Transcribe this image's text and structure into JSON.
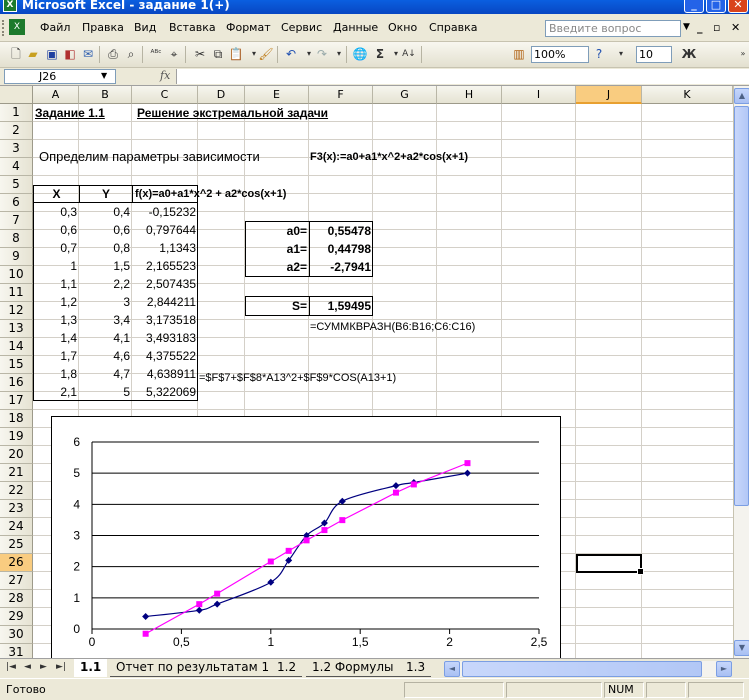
{
  "window": {
    "title": "Microsoft Excel - задание 1(+)"
  },
  "menu": {
    "items": [
      "Файл",
      "Правка",
      "Вид",
      "Вставка",
      "Формат",
      "Сервис",
      "Данные",
      "Окно",
      "Справка"
    ],
    "help_placeholder": "Введите вопрос"
  },
  "toolbar": {
    "zoom": "100%",
    "font_size": "10",
    "bold_label": "Ж"
  },
  "formula_bar": {
    "cell_ref": "J26",
    "fx_label": "fx",
    "content": ""
  },
  "columns": [
    "A",
    "B",
    "C",
    "D",
    "E",
    "F",
    "G",
    "H",
    "I",
    "J",
    "K"
  ],
  "selected_column": "J",
  "selected_row": "26",
  "rows": [
    "1",
    "2",
    "3",
    "4",
    "5",
    "6",
    "7",
    "8",
    "9",
    "10",
    "11",
    "12",
    "13",
    "14",
    "15",
    "16",
    "17",
    "18",
    "19",
    "20",
    "21",
    "22",
    "23",
    "24",
    "25",
    "26",
    "27",
    "28",
    "29",
    "30",
    "31"
  ],
  "sheet": {
    "title_task": "Задание 1.1",
    "title_solution": "Решение экстремальной задачи",
    "params_text": "Определим параметры зависимости",
    "params_formula": "F3(x):=a0+a1*x^2+a2*cos(x+1)",
    "table_headers": {
      "x": "X",
      "y": "Y",
      "f": "f(x)=a0+a1*x^2 + a2*cos(x+1)"
    },
    "table": [
      {
        "x": "0,3",
        "y": "0,4",
        "f": "-0,15232"
      },
      {
        "x": "0,6",
        "y": "0,6",
        "f": "0,797644"
      },
      {
        "x": "0,7",
        "y": "0,8",
        "f": "1,1343"
      },
      {
        "x": "1",
        "y": "1,5",
        "f": "2,165523"
      },
      {
        "x": "1,1",
        "y": "2,2",
        "f": "2,507435"
      },
      {
        "x": "1,2",
        "y": "3",
        "f": "2,844211"
      },
      {
        "x": "1,3",
        "y": "3,4",
        "f": "3,173518"
      },
      {
        "x": "1,4",
        "y": "4,1",
        "f": "3,493183"
      },
      {
        "x": "1,7",
        "y": "4,6",
        "f": "4,375522"
      },
      {
        "x": "1,8",
        "y": "4,7",
        "f": "4,638911"
      },
      {
        "x": "2,1",
        "y": "5",
        "f": "5,322069"
      }
    ],
    "row15_formula": "=$F$7+$F$8*A13^2+$F$9*COS(A13+1)",
    "params": [
      {
        "label": "a0=",
        "value": "0,55478"
      },
      {
        "label": "a1=",
        "value": "0,44798"
      },
      {
        "label": "a2=",
        "value": "-2,7941"
      }
    ],
    "s_label": "S=",
    "s_value": "1,59495",
    "s_formula": "=СУММКВРАЗН(B6:B16;C6:C16)"
  },
  "chart_data": {
    "type": "line",
    "x": [
      0.3,
      0.6,
      0.7,
      1,
      1.1,
      1.2,
      1.3,
      1.4,
      1.7,
      1.8,
      2.1
    ],
    "series": [
      {
        "name": "",
        "values": [
          0.4,
          0.6,
          0.8,
          1.5,
          2.2,
          3,
          3.4,
          4.1,
          4.6,
          4.7,
          5
        ],
        "color": "#000080",
        "marker": "diamond",
        "smooth": true
      },
      {
        "name": "",
        "values": [
          -0.15232,
          0.797644,
          1.1343,
          2.165523,
          2.507435,
          2.844211,
          3.173518,
          3.493183,
          4.375522,
          4.638911,
          5.322069
        ],
        "color": "#ff00ff",
        "marker": "square",
        "smooth": false
      }
    ],
    "xlim": [
      0,
      2.5
    ],
    "ylim": [
      0,
      6
    ],
    "x_ticks": [
      "0",
      "0,5",
      "1",
      "1,5",
      "2",
      "2,5"
    ],
    "y_ticks": [
      "0",
      "1",
      "2",
      "3",
      "4",
      "5",
      "6"
    ],
    "grid": "horizontal",
    "title": "",
    "xlabel": "",
    "ylabel": ""
  },
  "sheet_tabs": [
    "1.1",
    "Отчет по результатам 1",
    "1.2",
    "1.2 Формулы",
    "1.3"
  ],
  "active_tab": "1.1",
  "status": {
    "left": "Готово",
    "num": "NUM"
  }
}
